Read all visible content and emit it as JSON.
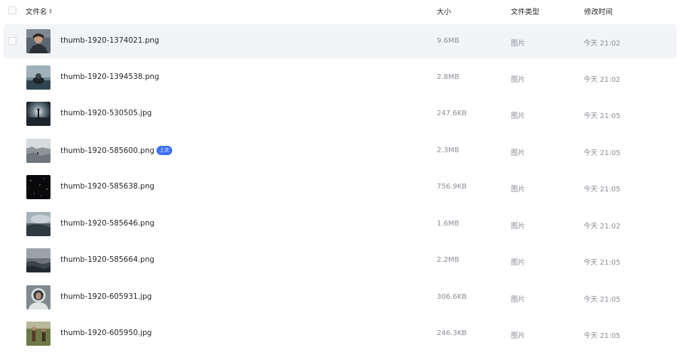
{
  "header": {
    "name_label": "文件名",
    "size_label": "大小",
    "type_label": "文件类型",
    "time_label": "修改时间"
  },
  "files": [
    {
      "name": "thumb-1920-1374021.png",
      "badge": "",
      "size": "9.6MB",
      "type": "图片",
      "modified": "今天 21:02",
      "thumb_icon": "portrait-photo-icon"
    },
    {
      "name": "thumb-1920-1394538.png",
      "badge": "",
      "size": "2.8MB",
      "type": "图片",
      "modified": "今天 21:02",
      "thumb_icon": "astronaut-water-photo-icon"
    },
    {
      "name": "thumb-1920-530505.jpg",
      "badge": "",
      "size": "247.6KB",
      "type": "图片",
      "modified": "今天 21:05",
      "thumb_icon": "silhouette-light-photo-icon"
    },
    {
      "name": "thumb-1920-585600.png",
      "badge": "上次",
      "size": "2.3MB",
      "type": "图片",
      "modified": "今天 21:05",
      "thumb_icon": "ice-landscape-photo-icon"
    },
    {
      "name": "thumb-1920-585638.png",
      "badge": "",
      "size": "756.9KB",
      "type": "图片",
      "modified": "今天 21:05",
      "thumb_icon": "dark-space-photo-icon"
    },
    {
      "name": "thumb-1920-585646.png",
      "badge": "",
      "size": "1.6MB",
      "type": "图片",
      "modified": "今天 21:02",
      "thumb_icon": "cloud-planet-photo-icon"
    },
    {
      "name": "thumb-1920-585664.png",
      "badge": "",
      "size": "2.2MB",
      "type": "图片",
      "modified": "今天 21:05",
      "thumb_icon": "ocean-wave-photo-icon"
    },
    {
      "name": "thumb-1920-605931.jpg",
      "badge": "",
      "size": "306.6KB",
      "type": "图片",
      "modified": "今天 21:05",
      "thumb_icon": "astronaut-helmet-photo-icon"
    },
    {
      "name": "thumb-1920-605950.jpg",
      "badge": "",
      "size": "246.3KB",
      "type": "图片",
      "modified": "今天 21:05",
      "thumb_icon": "field-people-photo-icon"
    }
  ],
  "colors": {
    "accent": "#3a6ff7",
    "hover_row": "#f3f4f7",
    "secondary_text": "#8a8d96",
    "primary_text": "#25262b"
  }
}
